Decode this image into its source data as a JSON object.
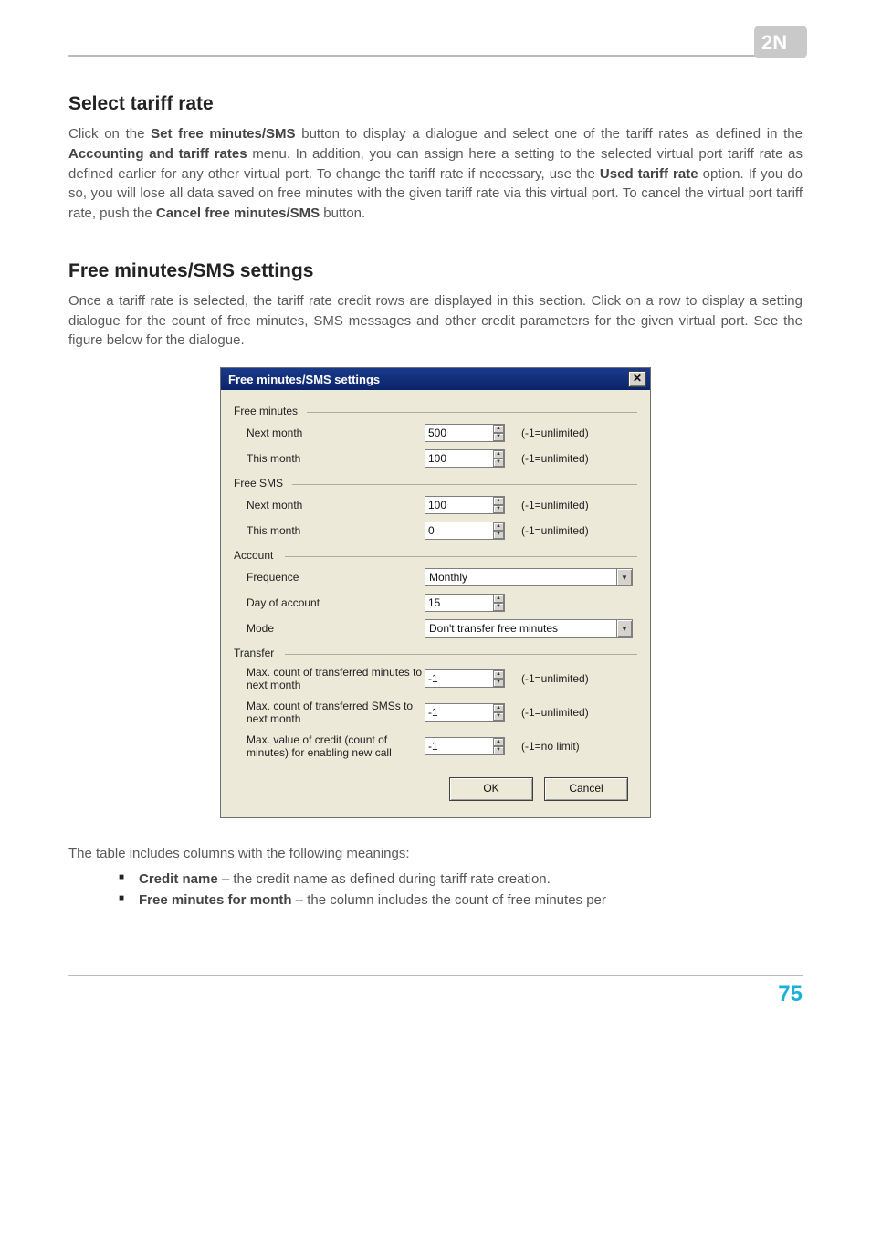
{
  "logo_label": "2N",
  "section1": {
    "title": "Select tariff rate",
    "body": "Click on the <b>Set free minutes/SMS</b> button to display a dialogue and select one of the tariff rates as defined in the <b>Accounting and tariff rates</b> menu. In addition, you can assign here a setting to the selected virtual port tariff rate as defined earlier for any other virtual port. To change the tariff rate if necessary, use the <b>Used tariff rate</b> option. If you do so, you will lose all data saved on free minutes with the given tariff rate via this virtual port. To cancel the virtual port tariff rate, push the <b>Cancel free minutes/SMS</b> button."
  },
  "section2": {
    "title": "Free minutes/SMS settings",
    "body": "Once a tariff rate is selected, the tariff rate credit rows are displayed in this section. Click on a row to display a setting dialogue for the count of free minutes, SMS messages and other credit parameters for the given virtual port. See the figure below for the dialogue."
  },
  "dialog": {
    "title": "Free minutes/SMS settings",
    "close_glyph": "✕",
    "hint_unlimited": "(-1=unlimited)",
    "hint_nolimit": "(-1=no limit)",
    "groups": {
      "free_min": {
        "label": "Free minutes",
        "next_month": {
          "label": "Next month",
          "value": "500"
        },
        "this_month": {
          "label": "This month",
          "value": "100"
        }
      },
      "free_sms": {
        "label": "Free SMS",
        "next_month": {
          "label": "Next month",
          "value": "100"
        },
        "this_month": {
          "label": "This month",
          "value": "0"
        }
      },
      "account": {
        "label": "Account",
        "frequence": {
          "label": "Frequence",
          "value": "Monthly"
        },
        "day": {
          "label": "Day of account",
          "value": "15"
        },
        "mode": {
          "label": "Mode",
          "value": "Don't transfer free minutes"
        }
      },
      "transfer": {
        "label": "Transfer",
        "max_min": {
          "label": "Max. count of transferred minutes to next month",
          "value": "-1"
        },
        "max_sms": {
          "label": "Max. count of transferred SMSs to next month",
          "value": "-1"
        },
        "max_credit": {
          "label": "Max. value of credit (count of minutes) for enabling new call",
          "value": "-1"
        }
      }
    },
    "ok": "OK",
    "cancel": "Cancel"
  },
  "after": {
    "intro": "The table includes columns with the following meanings:",
    "items": [
      {
        "name": "Credit name",
        "desc": " – the credit name as defined during tariff rate creation."
      },
      {
        "name": "Free minutes for month",
        "desc": " – the column includes the count of free minutes per"
      }
    ]
  },
  "page_number": "75"
}
